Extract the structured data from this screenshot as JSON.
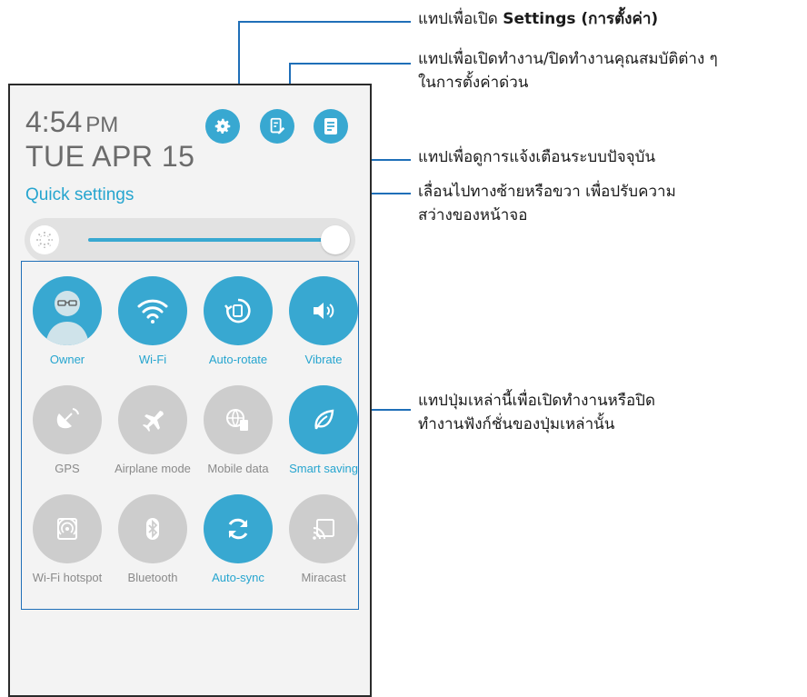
{
  "status": {
    "time": "4:54",
    "ampm": "PM",
    "date": "TUE APR 15"
  },
  "quick_settings": {
    "title": "Quick settings",
    "top_icons": [
      "gear-icon",
      "edit-settings-icon",
      "notifications-icon"
    ],
    "brightness_level": 0.95,
    "tiles": [
      {
        "label": "Owner",
        "icon": "owner-avatar-icon",
        "on": true
      },
      {
        "label": "Wi-Fi",
        "icon": "wifi-icon",
        "on": true
      },
      {
        "label": "Auto-rotate",
        "icon": "auto-rotate-icon",
        "on": true
      },
      {
        "label": "Vibrate",
        "icon": "vibrate-icon",
        "on": true
      },
      {
        "label": "GPS",
        "icon": "gps-icon",
        "on": false
      },
      {
        "label": "Airplane mode",
        "icon": "airplane-icon",
        "on": false
      },
      {
        "label": "Mobile data",
        "icon": "mobile-data-icon",
        "on": false
      },
      {
        "label": "Smart saving",
        "icon": "leaf-icon",
        "on": true
      },
      {
        "label": "Wi-Fi hotspot",
        "icon": "hotspot-icon",
        "on": false
      },
      {
        "label": "Bluetooth",
        "icon": "bluetooth-icon",
        "on": false
      },
      {
        "label": "Auto-sync",
        "icon": "sync-icon",
        "on": true
      },
      {
        "label": "Miracast",
        "icon": "miracast-icon",
        "on": false
      }
    ]
  },
  "callouts": {
    "settings": {
      "prefix": "แทปเพื่อเปิด ",
      "bold": "Settings (การตั้งค่า)"
    },
    "toggle_quick": {
      "line1": "แทปเพื่อเปิดทำงาน/ปิดทำงานคุณสมบัติต่าง ๆ",
      "line2": "ในการตั้งค่าด่วน"
    },
    "notifications": {
      "line1": "แทปเพื่อดูการแจ้งเตือนระบบปัจจุบัน"
    },
    "brightness": {
      "line1": "เลื่อนไปทางซ้ายหรือขวา เพื่อปรับความ",
      "line2": "สว่างของหน้าจอ"
    },
    "buttons": {
      "line1": "แทปปุ่มเหล่านี้เพื่อเปิดทำงานหรือปิด",
      "line2": "ทำงานฟังก์ชั่นของปุ่มเหล่านั้น"
    }
  },
  "colors": {
    "accent": "#38a8d1",
    "off": "#cdcdcd",
    "callout_line": "#1f6fb8"
  }
}
